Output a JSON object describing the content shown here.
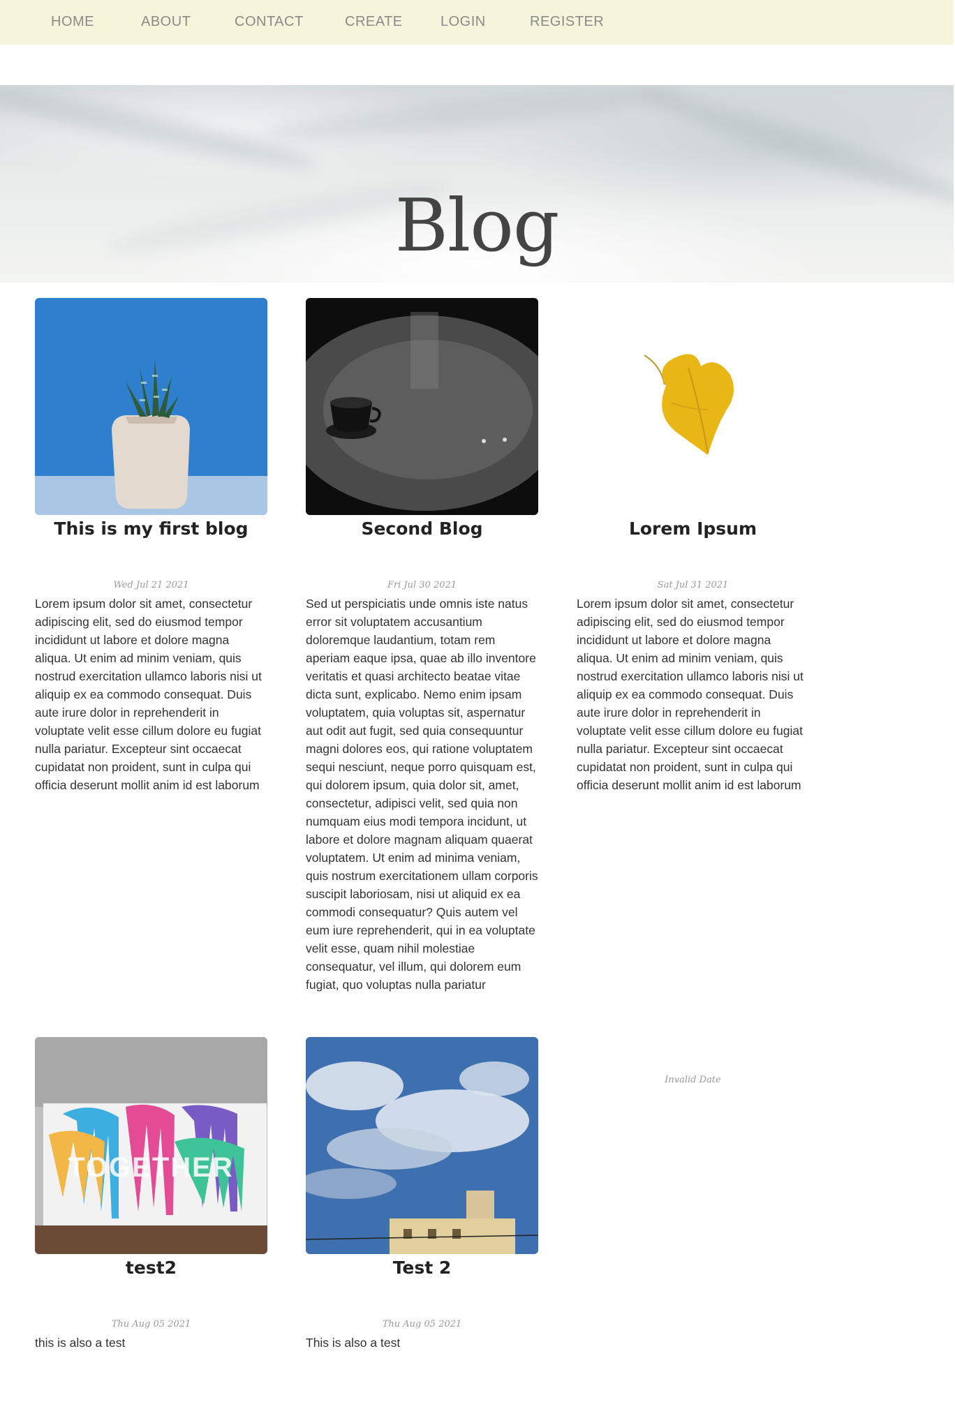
{
  "nav": {
    "items": [
      {
        "label": "HOME"
      },
      {
        "label": "ABOUT"
      },
      {
        "label": "CONTACT"
      },
      {
        "label": "CREATE"
      },
      {
        "label": "LOGIN"
      },
      {
        "label": "REGISTER"
      }
    ]
  },
  "hero": {
    "title": "Blog"
  },
  "posts": [
    {
      "title": "This is my first blog",
      "date": "Wed Jul 21 2021",
      "body": "Lorem ipsum dolor sit amet, consectetur adipiscing elit, sed do eiusmod tempor incididunt ut labore et dolore magna aliqua. Ut enim ad minim veniam, quis nostrud exercitation ullamco laboris nisi ut aliquip ex ea commodo consequat. Duis aute irure dolor in reprehenderit in voluptate velit esse cillum dolore eu fugiat nulla pariatur. Excepteur sint occaecat cupidatat non proident, sunt in culpa qui officia deserunt mollit anim id est laborum",
      "image": "potted-succulent-photo"
    },
    {
      "title": "Second Blog",
      "date": "Fri Jul 30 2021",
      "body": "Sed ut perspiciatis unde omnis iste natus error sit voluptatem accusantium doloremque laudantium, totam rem aperiam eaque ipsa, quae ab illo inventore veritatis et quasi architecto beatae vitae dicta sunt, explicabo. Nemo enim ipsam voluptatem, quia voluptas sit, aspernatur aut odit aut fugit, sed quia consequuntur magni dolores eos, qui ratione voluptatem sequi nesciunt, neque porro quisquam est, qui dolorem ipsum, quia dolor sit, amet, consectetur, adipisci velit, sed quia non numquam eius modi tempora incidunt, ut labore et dolore magnam aliquam quaerat voluptatem. Ut enim ad minima veniam, quis nostrum exercitationem ullam corporis suscipit laboriosam, nisi ut aliquid ex ea commodi consequatur? Quis autem vel eum iure reprehenderit, qui in ea voluptate velit esse, quam nihil molestiae consequatur, vel illum, qui dolorem eum fugiat, quo voluptas nulla pariatur",
      "image": "coffee-cup-on-table-photo"
    },
    {
      "title": "Lorem Ipsum",
      "date": "Sat Jul 31 2021",
      "body": "Lorem ipsum dolor sit amet, consectetur adipiscing elit, sed do eiusmod tempor incididunt ut labore et dolore magna aliqua. Ut enim ad minim veniam, quis nostrud exercitation ullamco laboris nisi ut aliquip ex ea commodo consequat. Duis aute irure dolor in reprehenderit in voluptate velit esse cillum dolore eu fugiat nulla pariatur. Excepteur sint occaecat cupidatat non proident, sunt in culpa qui officia deserunt mollit anim id est laborum",
      "image": "yellow-leaf-image"
    },
    {
      "title": "test2",
      "date": "Thu Aug 05 2021",
      "body": "this is also a test",
      "image": "together-graffiti-wall-photo",
      "image_text": "TOGETHER"
    },
    {
      "title": "Test 2",
      "date": "Thu Aug 05 2021",
      "body": "This is also a test",
      "image": "cloudy-sky-photo"
    }
  ],
  "orphan_date": "Invalid Date",
  "colors": {
    "nav_bg": "#f6f5dc",
    "nav_text": "#8a8a8a",
    "hero_title": "#444444",
    "date_text": "#9a9a9a"
  }
}
